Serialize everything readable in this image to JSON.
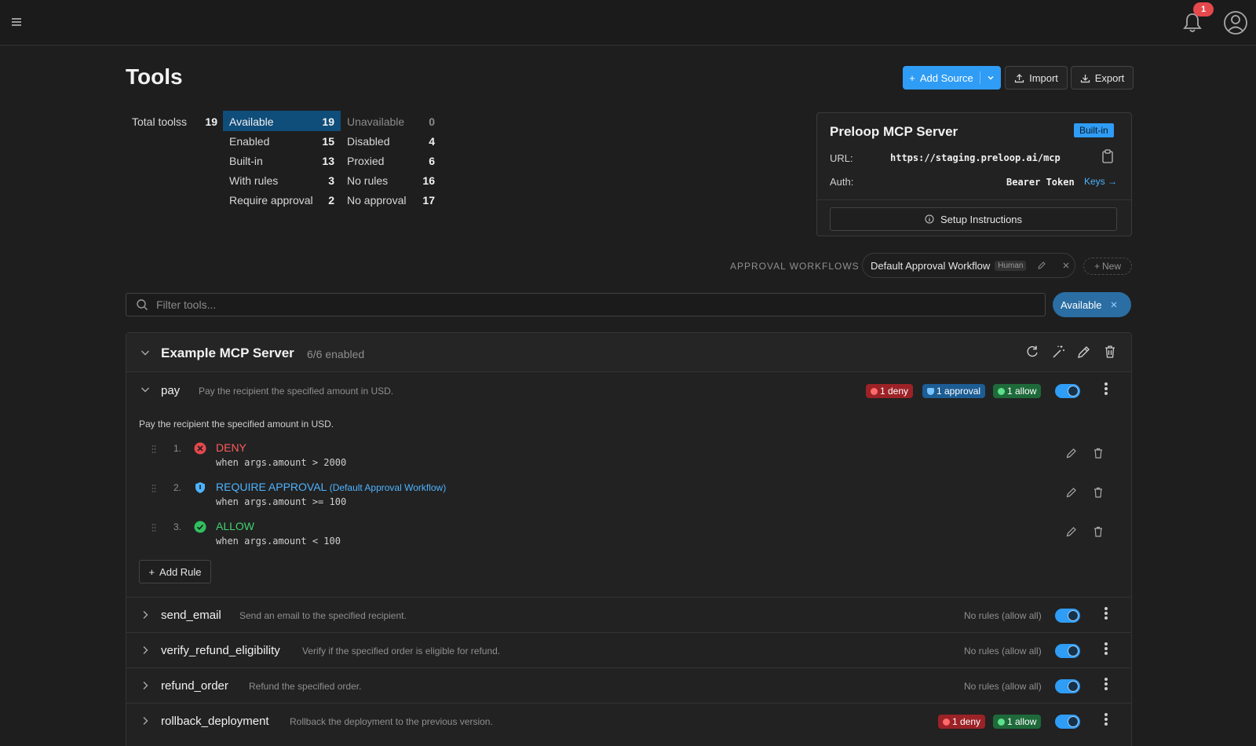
{
  "header": {
    "title": "Tools",
    "notifications": "1",
    "add_source_label": "Add Source",
    "import_label": "Import",
    "export_label": "Export"
  },
  "stats": {
    "total_label": "Total toolss",
    "total_value": "19",
    "left": [
      {
        "label": "Available",
        "value": "19"
      },
      {
        "label": "Enabled",
        "value": "15"
      },
      {
        "label": "Built-in",
        "value": "13"
      },
      {
        "label": "With rules",
        "value": "3"
      },
      {
        "label": "Require approval",
        "value": "2"
      }
    ],
    "right": [
      {
        "label": "Unavailable",
        "value": "0"
      },
      {
        "label": "Disabled",
        "value": "4"
      },
      {
        "label": "Proxied",
        "value": "6"
      },
      {
        "label": "No rules",
        "value": "16"
      },
      {
        "label": "No approval",
        "value": "17"
      }
    ]
  },
  "server_card": {
    "title": "Preloop MCP Server",
    "badge": "Built-in",
    "url_label": "URL:",
    "url_value": "https://staging.preloop.ai/mcp",
    "auth_label": "Auth:",
    "auth_value": "Bearer Token",
    "keys_link": "Keys →",
    "setup_label": "Setup Instructions"
  },
  "approval_workflows": {
    "label": "APPROVAL WORKFLOWS",
    "workflow_name": "Default Approval Workflow",
    "workflow_badge": "Human",
    "new_label": "New"
  },
  "filter": {
    "placeholder": "Filter tools...",
    "active_chip": "Available"
  },
  "group": {
    "title": "Example MCP Server",
    "count": "6/6 enabled"
  },
  "tools": {
    "pay": {
      "name": "pay",
      "desc": "Pay the recipient the specified amount in USD.",
      "detail": "Pay the recipient the specified amount in USD.",
      "badges": {
        "deny": "1 deny",
        "approval": "1 approval",
        "allow": "1 allow"
      },
      "rules": [
        {
          "num": "1.",
          "action": "DENY",
          "workflow": "",
          "cond": "when args.amount > 2000"
        },
        {
          "num": "2.",
          "action": "REQUIRE APPROVAL",
          "workflow": "(Default Approval Workflow)",
          "cond": "when args.amount >= 100"
        },
        {
          "num": "3.",
          "action": "ALLOW",
          "workflow": "",
          "cond": "when args.amount < 100"
        }
      ],
      "add_rule_label": "Add Rule"
    },
    "send_email": {
      "name": "send_email",
      "desc": "Send an email to the specified recipient.",
      "status": "No rules (allow all)"
    },
    "verify_refund": {
      "name": "verify_refund_eligibility",
      "desc": "Verify if the specified order is eligible for refund.",
      "status": "No rules (allow all)"
    },
    "refund_order": {
      "name": "refund_order",
      "desc": "Refund the specified order.",
      "status": "No rules (allow all)"
    },
    "rollback": {
      "name": "rollback_deployment",
      "desc": "Rollback the deployment to the previous version.",
      "badges": {
        "deny": "1 deny",
        "allow": "1 allow"
      }
    }
  },
  "colors": {
    "accent": "#2f9cf5",
    "deny": "#e5484d",
    "approval": "#2f9cf5",
    "allow": "#30c060"
  }
}
